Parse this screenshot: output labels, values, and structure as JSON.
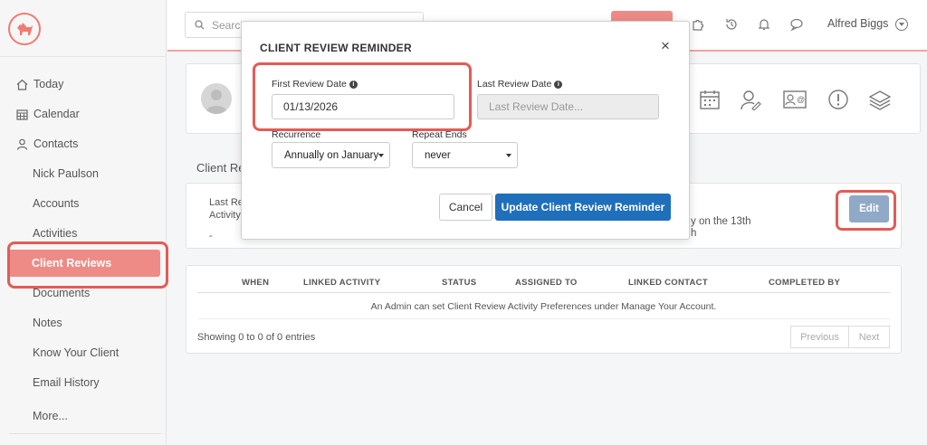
{
  "colors": {
    "accent": "#ee8b86",
    "highlight": "#e25c56",
    "primary": "#1f6fba",
    "edit_button": "#8fa9c6"
  },
  "sidebar": {
    "logo_icon": "dog-logo-icon",
    "items": [
      {
        "label": "Today",
        "icon": "home-icon"
      },
      {
        "label": "Calendar",
        "icon": "calendar-icon"
      },
      {
        "label": "Contacts",
        "icon": "person-icon"
      },
      {
        "label": "Nick Paulson"
      },
      {
        "label": "Accounts"
      },
      {
        "label": "Activities"
      },
      {
        "label": "Client Reviews",
        "active": true
      },
      {
        "label": "Documents"
      },
      {
        "label": "Notes"
      },
      {
        "label": "Know Your Client"
      },
      {
        "label": "Email History"
      },
      {
        "label": "More..."
      }
    ]
  },
  "topbar": {
    "search_placeholder": "Search",
    "icons": [
      "puzzle-icon",
      "history-icon",
      "bell-icon",
      "chat-icon"
    ],
    "user_name": "Alfred Biggs"
  },
  "profile": {
    "icons": [
      "calendar-grid-icon",
      "person-edit-icon",
      "contact-card-icon",
      "alert-icon",
      "layers-icon"
    ]
  },
  "review": {
    "section_title": "Client Re",
    "last_review_label_1": "Last Re",
    "last_review_label_2": "Activity",
    "last_review_value": "-",
    "recurrence_text_1": "y on the 13th",
    "recurrence_text_2": "h",
    "edit_label": "Edit"
  },
  "table": {
    "columns": [
      "WHEN",
      "LINKED ACTIVITY",
      "STATUS",
      "ASSIGNED TO",
      "LINKED CONTACT",
      "COMPLETED BY"
    ],
    "empty_message": "An Admin can set Client Review Activity Preferences under Manage Your Account.",
    "showing": "Showing 0 to 0 of 0 entries",
    "previous": "Previous",
    "next": "Next"
  },
  "modal": {
    "title": "CLIENT REVIEW REMINDER",
    "close": "×",
    "first_review_label": "First Review Date",
    "first_review_value": "01/13/2026",
    "last_review_label": "Last Review Date",
    "last_review_placeholder": "Last Review Date...",
    "recurrence_label": "Recurrence",
    "recurrence_value": "Annually on January",
    "repeat_ends_label": "Repeat Ends",
    "repeat_ends_value": "never",
    "cancel_label": "Cancel",
    "update_label": "Update Client Review Reminder"
  }
}
